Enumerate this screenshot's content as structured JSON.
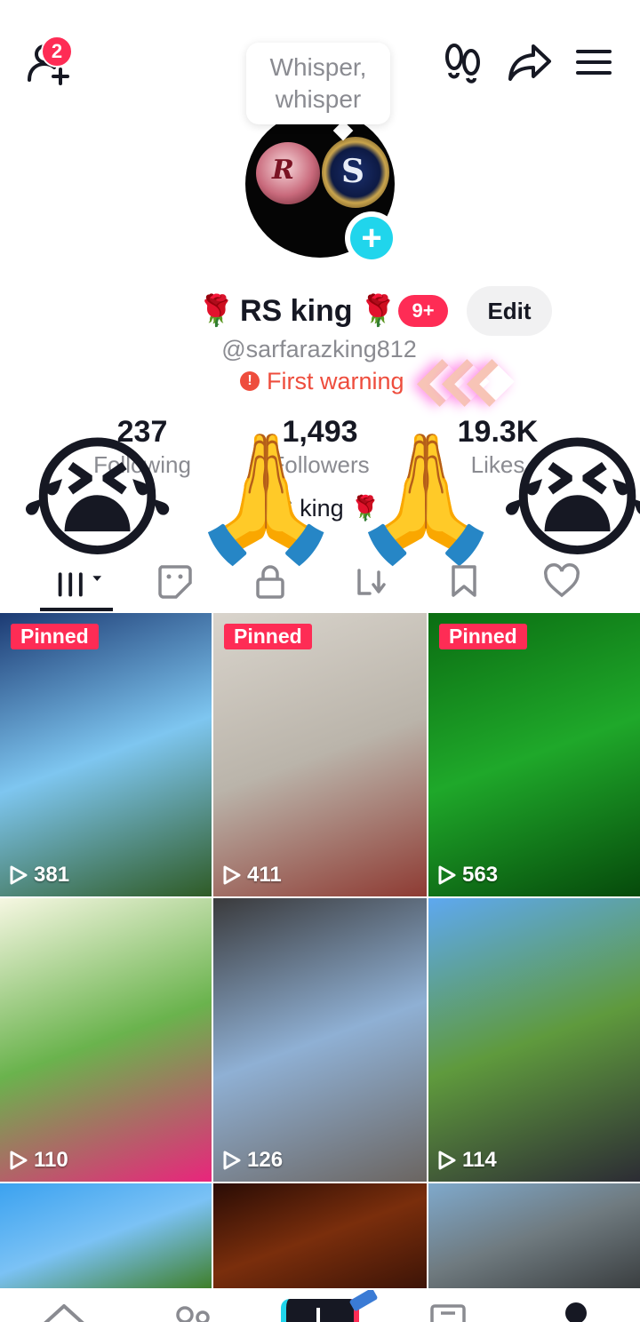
{
  "header": {
    "notification_count": "2",
    "tooltip_line1": "Whisper,",
    "tooltip_line2": "whisper"
  },
  "profile": {
    "display_name": "RS king",
    "name_emoji": "🌹",
    "badge": "9+",
    "edit_label": "Edit",
    "username": "@sarfarazking812",
    "warning": "First warning",
    "avatar_left_letter": "R",
    "avatar_right_letter": "S",
    "bio": "RS king 🌹"
  },
  "stats": [
    {
      "value": "237",
      "label": "Following"
    },
    {
      "value": "1,493",
      "label": "Followers"
    },
    {
      "value": "19.3K",
      "label": "Likes"
    }
  ],
  "overlay_emojis": {
    "cry": "😭",
    "pray": "🙏"
  },
  "tabs": [
    "videos-tab",
    "stickers-tab",
    "lock-tab",
    "repost-tab",
    "saved-tab",
    "liked-tab"
  ],
  "videos": [
    {
      "pinned": "Pinned",
      "views": "381",
      "colors": [
        "#1c3a73",
        "#7ec6f0",
        "#2f5b26"
      ]
    },
    {
      "pinned": "Pinned",
      "views": "411",
      "colors": [
        "#d9d4cc",
        "#bab4aa",
        "#8e3b33"
      ]
    },
    {
      "pinned": "Pinned",
      "views": "563",
      "colors": [
        "#0b6d12",
        "#1fa82a",
        "#064a0b"
      ]
    },
    {
      "pinned": "",
      "views": "110",
      "colors": [
        "#f6f7e2",
        "#6ab34d",
        "#e9257c"
      ]
    },
    {
      "pinned": "",
      "views": "126",
      "colors": [
        "#3a3a3c",
        "#8fb0d4",
        "#6b6561"
      ]
    },
    {
      "pinned": "",
      "views": "114",
      "colors": [
        "#5ea8f0",
        "#5f9a3d",
        "#2c2c34"
      ]
    },
    {
      "pinned": "",
      "views": "",
      "colors": [
        "#3ba2f0",
        "#7bc2f5",
        "#3f7f2a"
      ]
    },
    {
      "pinned": "",
      "views": "",
      "colors": [
        "#2a0c05",
        "#7a2e0c",
        "#3d1407"
      ]
    },
    {
      "pinned": "",
      "views": "",
      "colors": [
        "#7fa9cc",
        "#6f7a7f",
        "#3a3e40"
      ]
    }
  ],
  "colors": {
    "accent": "#fe2c55",
    "warning": "#ee4d3d",
    "add_button": "#20d5ec",
    "secondary_text": "#8a8b91"
  },
  "bottom_nav": [
    "home-icon",
    "friends-icon",
    "create-button",
    "inbox-icon",
    "profile-icon"
  ]
}
